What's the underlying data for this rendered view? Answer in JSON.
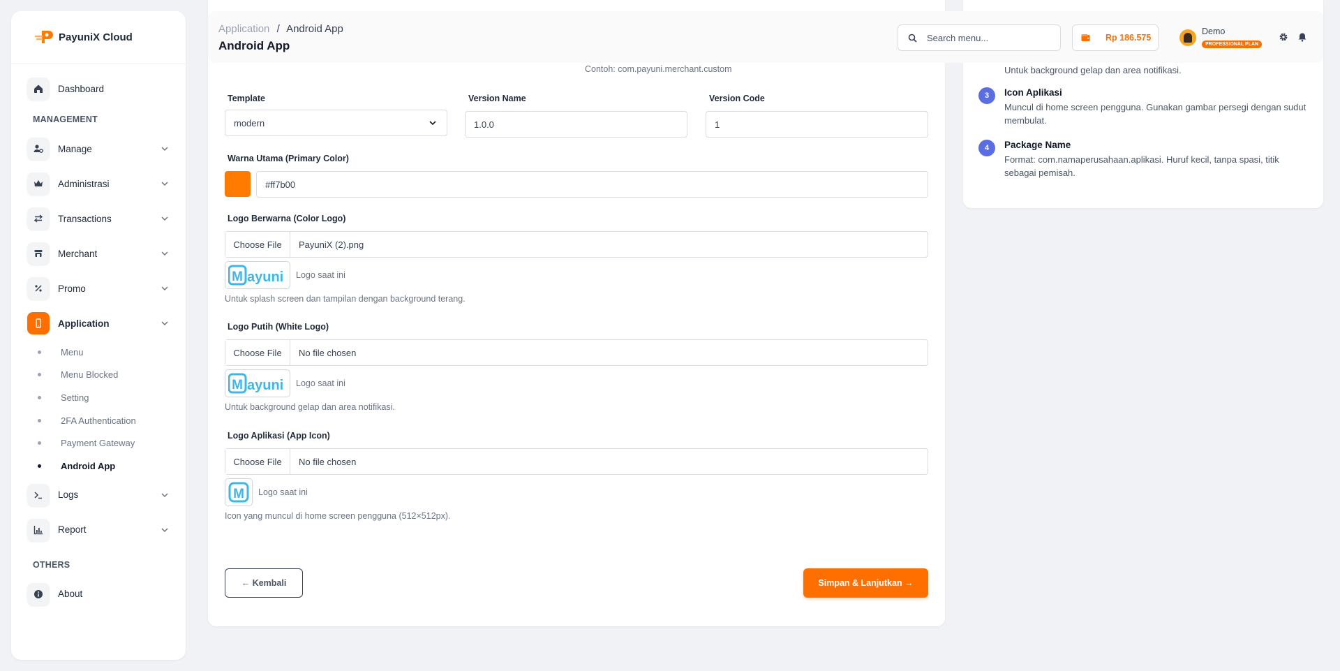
{
  "brand": {
    "name": "PayuniX Cloud"
  },
  "sidebar": {
    "dashboard": "Dashboard",
    "management_title": "MANAGEMENT",
    "items": [
      {
        "label": "Manage",
        "icon": "user-gear-icon"
      },
      {
        "label": "Administrasi",
        "icon": "crown-icon"
      },
      {
        "label": "Transactions",
        "icon": "arrows-exchange-icon"
      },
      {
        "label": "Merchant",
        "icon": "store-icon"
      },
      {
        "label": "Promo",
        "icon": "percent-icon"
      },
      {
        "label": "Application",
        "icon": "mobile-icon"
      }
    ],
    "sub_items": [
      "Menu",
      "Menu Blocked",
      "Setting",
      "2FA Authentication",
      "Payment Gateway",
      "Android App"
    ],
    "logs": "Logs",
    "report": "Report",
    "others_title": "OTHERS",
    "about": "About"
  },
  "header": {
    "breadcrumb_parent": "Application",
    "breadcrumb_sep": "/",
    "breadcrumb_current": "Android App",
    "title": "Android App",
    "search_placeholder": "Search menu...",
    "balance": "Rp 186.575",
    "user_name": "Demo",
    "plan": "PROFESSIONAL PLAN"
  },
  "form": {
    "package_hint": "Contoh: com.payuni.merchant.custom",
    "template_label": "Template",
    "template_value": "modern",
    "version_name_label": "Version Name",
    "version_name_value": "1.0.0",
    "version_code_label": "Version Code",
    "version_code_value": "1",
    "primary_color_label": "Warna Utama (Primary Color)",
    "primary_color_value": "#ff7b00",
    "color_logo_label": "Logo Berwarna (Color Logo)",
    "choose_file": "Choose File",
    "color_logo_file": "PayuniX (2).png",
    "current_logo": "Logo saat ini",
    "color_logo_help": "Untuk splash screen dan tampilan dengan background terang.",
    "white_logo_label": "Logo Putih (White Logo)",
    "white_logo_file": "No file chosen",
    "white_logo_help": "Untuk background gelap dan area notifikasi.",
    "app_icon_label": "Logo Aplikasi (App Icon)",
    "app_icon_file": "No file chosen",
    "app_icon_help": "Icon yang muncul di home screen pengguna (512×512px).",
    "back_button": "← Kembali",
    "save_button": "Simpan & Lanjutkan →",
    "logo_text": "ayuni",
    "icon_letter": "M"
  },
  "guide": {
    "partial_desc": "Untuk background gelap dan area notifikasi.",
    "steps": [
      {
        "num": "3",
        "title": "Icon Aplikasi",
        "desc": "Muncul di home screen pengguna. Gunakan gambar persegi dengan sudut membulat."
      },
      {
        "num": "4",
        "title": "Package Name",
        "desc": "Format: com.namaperusahaan.aplikasi. Huruf kecil, tanpa spasi, titik sebagai pemisah."
      }
    ]
  },
  "colors": {
    "accent": "#ff6f00",
    "step": "#5b6ee1",
    "logo_blue": "#3fb6e8"
  }
}
